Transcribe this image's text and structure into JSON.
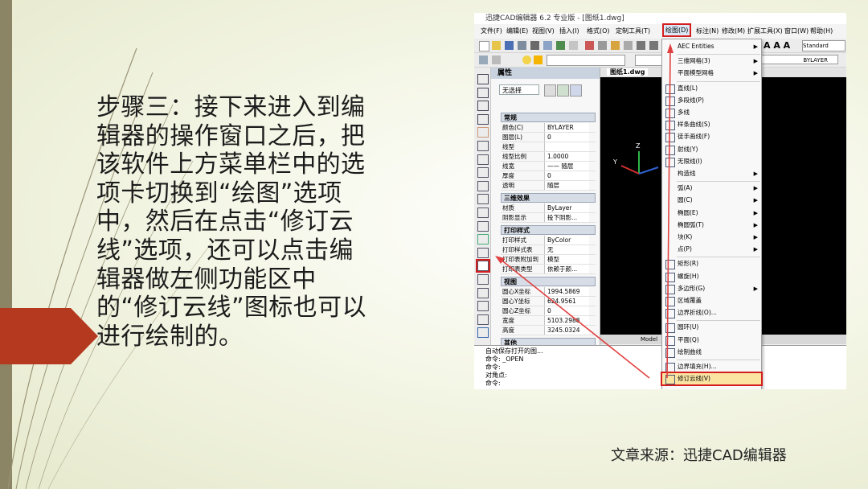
{
  "slide": {
    "body": "步骤三：接下来进入到编辑器的操作窗口之后，把该软件上方菜单栏中的选项卡切换到“绘图”选项中，然后在点击“修订云线”选项，还可以点击编辑器做左侧功能区中的“修订云线”图标也可以进行绘制的。",
    "source": "文章来源：迅捷CAD编辑器"
  },
  "colors": {
    "accent_red": "#d41e1e",
    "left_bar": "#8b8566",
    "arrow": "#b5391f"
  },
  "app": {
    "title": "迅捷CAD编辑器 6.2 专业版 - [图纸1.dwg]",
    "menu": [
      "文件(F)",
      "编辑(E)",
      "视图(V)",
      "插入(I)",
      "格式(O)",
      "定制工具(T)",
      "绘图(D)",
      "标注(N)",
      "修改(M)",
      "扩展工具(X)",
      "窗口(W)",
      "帮助(H)"
    ],
    "layer_value": "BYLAYER",
    "style_value": "Standard",
    "doc_tab": "图纸1.dwg",
    "model_tab": "Model"
  },
  "props": {
    "title": "属性",
    "selector": "无选择",
    "sections": [
      {
        "name": "常规",
        "rows": [
          [
            "颜色(C)",
            "BYLAYER"
          ],
          [
            "图层(L)",
            "0"
          ],
          [
            "线型",
            ""
          ],
          [
            "线型比例",
            "1.0000"
          ],
          [
            "线宽",
            "—— 随层"
          ],
          [
            "厚度",
            "0"
          ],
          [
            "透明",
            "随层"
          ]
        ]
      },
      {
        "name": "三维效果",
        "rows": [
          [
            "材质",
            "ByLayer"
          ],
          [
            "阴影显示",
            "投下阴影..."
          ]
        ]
      },
      {
        "name": "打印样式",
        "rows": [
          [
            "打印样式",
            "ByColor"
          ],
          [
            "打印样式表",
            "无"
          ],
          [
            "打印表附加到",
            "模型"
          ],
          [
            "打印表类型",
            "依赖于颜..."
          ]
        ]
      },
      {
        "name": "视图",
        "rows": [
          [
            "圆心X坐标",
            "1994.5869"
          ],
          [
            "圆心Y坐标",
            "624.9561"
          ],
          [
            "圆心Z坐标",
            "0"
          ],
          [
            "宽度",
            "5103.2988"
          ],
          [
            "高度",
            "3245.0324"
          ]
        ]
      },
      {
        "name": "其他",
        "rows": []
      }
    ]
  },
  "command": {
    "lines": [
      "自动保存打开的图...",
      "命令: _OPEN",
      "命令:",
      "对角点:",
      "命令:"
    ]
  },
  "dropdown": {
    "items": [
      {
        "label": "AEC Entities",
        "arrow": "▶",
        "icon": ""
      },
      {
        "label": "三维网格(3)",
        "arrow": "▶",
        "icon": ""
      },
      {
        "label": "平面模型网格",
        "arrow": "▶",
        "icon": ""
      },
      {
        "label": "直线(L)",
        "arrow": "",
        "icon": "line-icon"
      },
      {
        "label": "多段线(P)",
        "arrow": "",
        "icon": "polyline-icon"
      },
      {
        "label": "多线",
        "arrow": "",
        "icon": "multiline-icon"
      },
      {
        "label": "样条曲线(S)",
        "arrow": "",
        "icon": "spline-icon"
      },
      {
        "label": "徒手画线(F)",
        "arrow": "",
        "icon": "freehand-icon"
      },
      {
        "label": "射线(Y)",
        "arrow": "",
        "icon": "ray-icon"
      },
      {
        "label": "无限线(I)",
        "arrow": "",
        "icon": "xline-icon"
      },
      {
        "label": "构造线",
        "arrow": "▶",
        "icon": ""
      },
      {
        "label": "弧(A)",
        "arrow": "▶",
        "icon": ""
      },
      {
        "label": "圆(C)",
        "arrow": "▶",
        "icon": ""
      },
      {
        "label": "椭圆(E)",
        "arrow": "▶",
        "icon": ""
      },
      {
        "label": "椭圆弧(T)",
        "arrow": "▶",
        "icon": ""
      },
      {
        "label": "块(K)",
        "arrow": "▶",
        "icon": ""
      },
      {
        "label": "点(P)",
        "arrow": "▶",
        "icon": ""
      },
      {
        "label": "矩形(R)",
        "arrow": "",
        "icon": "rectangle-icon"
      },
      {
        "label": "螺旋(H)",
        "arrow": "",
        "icon": "helix-icon"
      },
      {
        "label": "多边形(G)",
        "arrow": "▶",
        "icon": "polygon-icon"
      },
      {
        "label": "区域覆盖",
        "arrow": "",
        "icon": "wipeout-icon"
      },
      {
        "label": "边界折线(O)...",
        "arrow": "",
        "icon": "boundary-icon"
      },
      {
        "label": "圆环(U)",
        "arrow": "",
        "icon": "donut-icon"
      },
      {
        "label": "平面(Q)",
        "arrow": "",
        "icon": "plane-icon"
      },
      {
        "label": "绘制曲线",
        "arrow": "",
        "icon": "curve-icon"
      },
      {
        "label": "边界填充(H)...",
        "arrow": "",
        "icon": "hatch-icon"
      },
      {
        "label": "修订云线(V)",
        "arrow": "",
        "icon": "revcloud-icon"
      }
    ]
  }
}
